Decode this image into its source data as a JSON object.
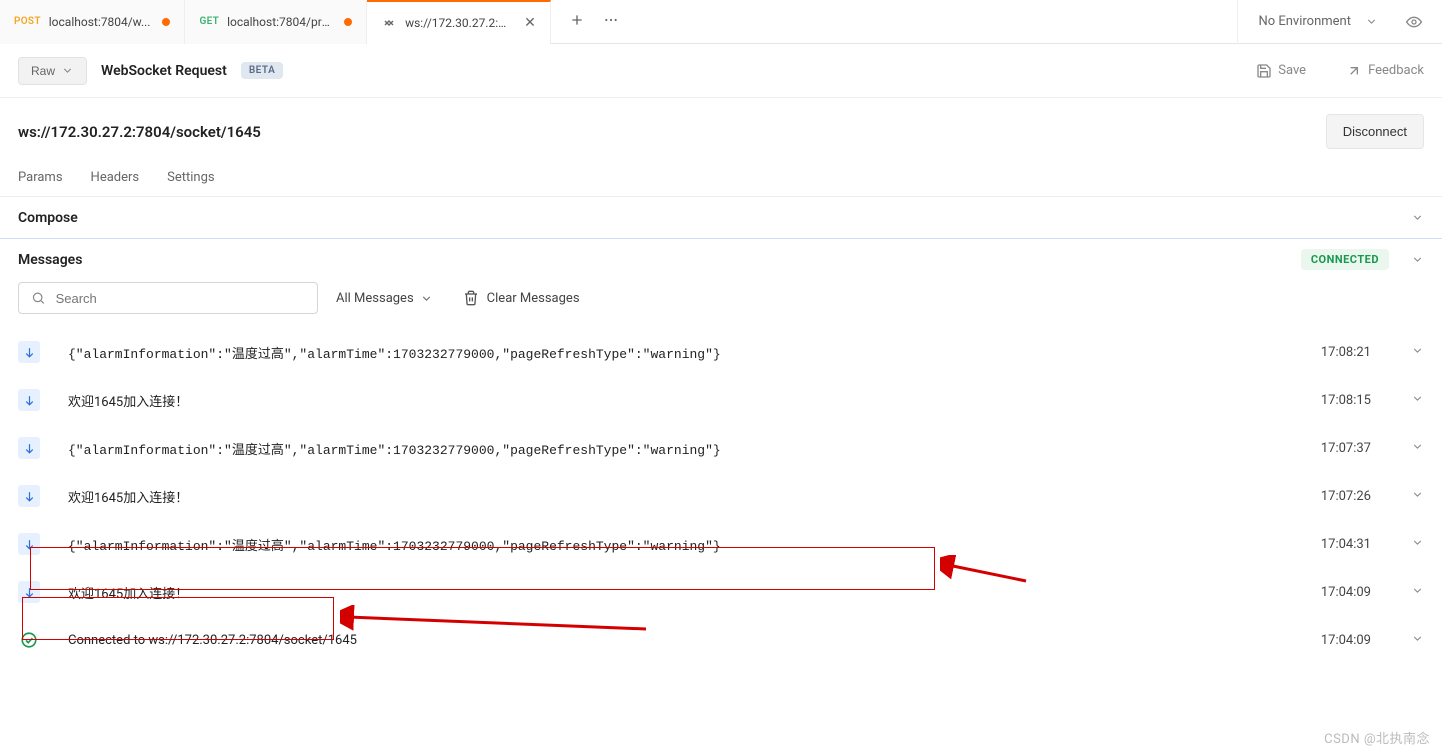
{
  "tabs": [
    {
      "method": "POST",
      "methodClass": "method-post",
      "title": "localhost:7804/w...",
      "unsaved": true,
      "active": false
    },
    {
      "method": "GET",
      "methodClass": "method-get",
      "title": "localhost:7804/pri...",
      "unsaved": true,
      "active": false
    },
    {
      "method": "WS",
      "methodClass": "",
      "title": "ws://172.30.27.2:7...",
      "unsaved": false,
      "active": true,
      "closeable": true
    }
  ],
  "environment": {
    "label": "No Environment"
  },
  "request": {
    "raw_label": "Raw",
    "name": "WebSocket Request",
    "beta": "BETA",
    "save_label": "Save",
    "feedback_label": "Feedback",
    "url": "ws://172.30.27.2:7804/socket/1645",
    "disconnect_label": "Disconnect",
    "subtabs": [
      "Params",
      "Headers",
      "Settings"
    ]
  },
  "compose": {
    "label": "Compose"
  },
  "messages": {
    "title": "Messages",
    "status": "CONNECTED",
    "search_placeholder": "Search",
    "filter_label": "All Messages",
    "clear_label": "Clear Messages",
    "rows": [
      {
        "dir": "down",
        "body": "{\"alarmInformation\":\"温度过高\",\"alarmTime\":1703232779000,\"pageRefreshType\":\"warning\"}",
        "time": "17:08:21"
      },
      {
        "dir": "down",
        "body": "欢迎1645加入连接！",
        "time": "17:08:15",
        "sys": true
      },
      {
        "dir": "down",
        "body": "{\"alarmInformation\":\"温度过高\",\"alarmTime\":1703232779000,\"pageRefreshType\":\"warning\"}",
        "time": "17:07:37"
      },
      {
        "dir": "down",
        "body": "欢迎1645加入连接！",
        "time": "17:07:26",
        "sys": true
      },
      {
        "dir": "down",
        "body": "{\"alarmInformation\":\"温度过高\",\"alarmTime\":1703232779000,\"pageRefreshType\":\"warning\"}",
        "time": "17:04:31"
      },
      {
        "dir": "down",
        "body": "欢迎1645加入连接！",
        "time": "17:04:09",
        "sys": true
      },
      {
        "dir": "connected",
        "body": "Connected to ws://172.30.27.2:7804/socket/1645",
        "time": "17:04:09",
        "sys": true
      }
    ]
  },
  "watermark": "CSDN @北执南念"
}
